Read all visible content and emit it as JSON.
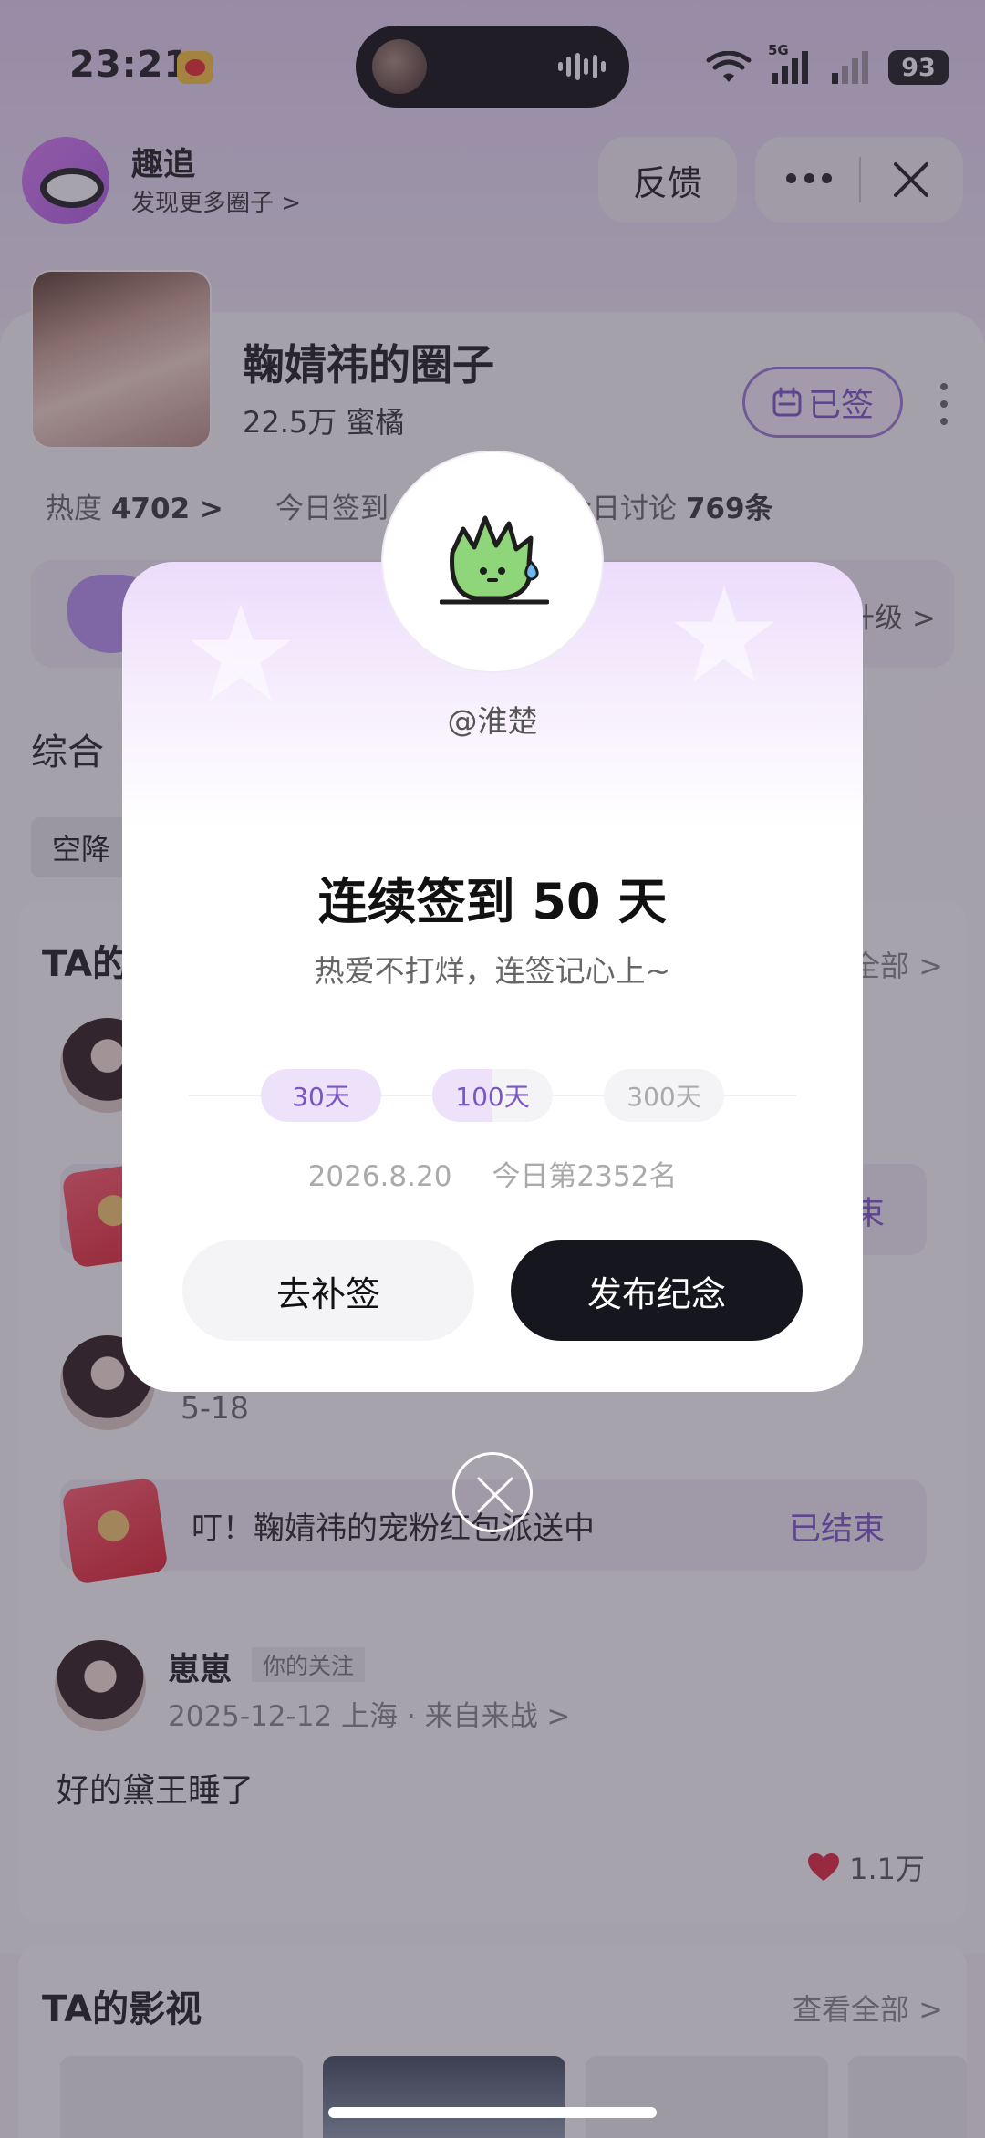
{
  "status_bar": {
    "time": "23:21",
    "network": "5G",
    "battery": "93"
  },
  "mini_app": {
    "name": "趣追",
    "subtitle": "发现更多圈子 >",
    "feedback": "反馈"
  },
  "circle": {
    "name": "鞠婧祎的圈子",
    "fans": "22.5万 蜜橘",
    "signed_label": "已签",
    "stats": [
      {
        "label": "热度",
        "value": "4702 >"
      },
      {
        "label": "今日签到",
        "value": ""
      },
      {
        "label": "今日讨论",
        "value": "769条"
      }
    ],
    "level_hint": "升级 >"
  },
  "tabs": {
    "all": "综合"
  },
  "filter_chip": "空降",
  "posts_section": {
    "title": "TA的",
    "more": "全部 >"
  },
  "redpack_rows": [
    {
      "text": "",
      "status": "束"
    },
    {
      "text": "叮！鞠婧祎的宠粉红包派送中",
      "status": "已结束"
    }
  ],
  "post_2_date": "5-18",
  "post": {
    "author": "崽崽",
    "follow_tag": "你的关注",
    "meta": "2025-12-12 上海 · 来自来战 >",
    "text": "好的黛王睡了",
    "likes": "1.1万"
  },
  "films_section": {
    "title": "TA的影视",
    "more": "查看全部 >"
  },
  "modal": {
    "handle": "@淮楚",
    "title": "连续签到 50 天",
    "subtitle": "热爱不打烊，连签记心上~",
    "milestones": [
      "30天",
      "100天",
      "300天"
    ],
    "date": "2026.8.20",
    "rank": "今日第2352名",
    "btn_makeup": "去补签",
    "btn_publish": "发布纪念"
  },
  "colors": {
    "accent": "#7a55c8",
    "dark_button": "#16161e"
  }
}
